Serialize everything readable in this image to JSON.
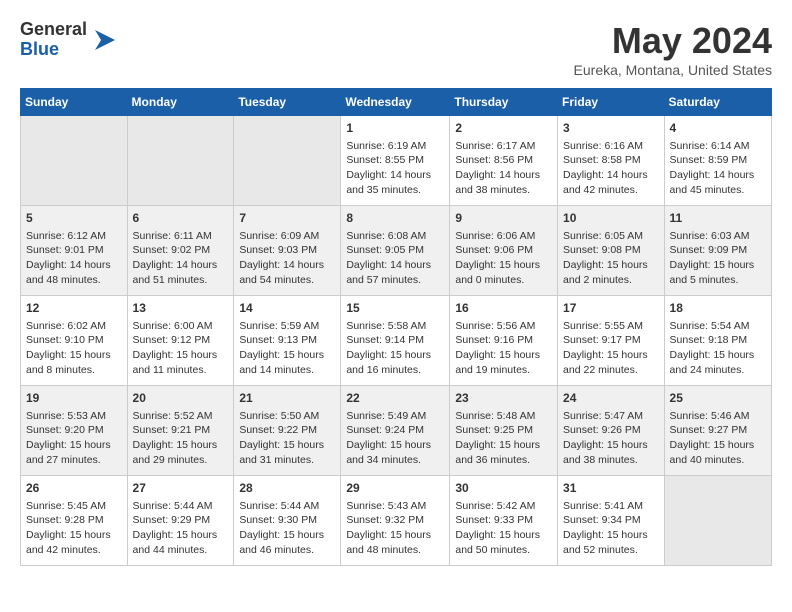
{
  "logo": {
    "general": "General",
    "blue": "Blue"
  },
  "title": "May 2024",
  "location": "Eureka, Montana, United States",
  "weekdays": [
    "Sunday",
    "Monday",
    "Tuesday",
    "Wednesday",
    "Thursday",
    "Friday",
    "Saturday"
  ],
  "weeks": [
    [
      {
        "day": "",
        "empty": true
      },
      {
        "day": "",
        "empty": true
      },
      {
        "day": "",
        "empty": true
      },
      {
        "day": "1",
        "sunrise": "Sunrise: 6:19 AM",
        "sunset": "Sunset: 8:55 PM",
        "daylight": "Daylight: 14 hours and 35 minutes."
      },
      {
        "day": "2",
        "sunrise": "Sunrise: 6:17 AM",
        "sunset": "Sunset: 8:56 PM",
        "daylight": "Daylight: 14 hours and 38 minutes."
      },
      {
        "day": "3",
        "sunrise": "Sunrise: 6:16 AM",
        "sunset": "Sunset: 8:58 PM",
        "daylight": "Daylight: 14 hours and 42 minutes."
      },
      {
        "day": "4",
        "sunrise": "Sunrise: 6:14 AM",
        "sunset": "Sunset: 8:59 PM",
        "daylight": "Daylight: 14 hours and 45 minutes."
      }
    ],
    [
      {
        "day": "5",
        "sunrise": "Sunrise: 6:12 AM",
        "sunset": "Sunset: 9:01 PM",
        "daylight": "Daylight: 14 hours and 48 minutes."
      },
      {
        "day": "6",
        "sunrise": "Sunrise: 6:11 AM",
        "sunset": "Sunset: 9:02 PM",
        "daylight": "Daylight: 14 hours and 51 minutes."
      },
      {
        "day": "7",
        "sunrise": "Sunrise: 6:09 AM",
        "sunset": "Sunset: 9:03 PM",
        "daylight": "Daylight: 14 hours and 54 minutes."
      },
      {
        "day": "8",
        "sunrise": "Sunrise: 6:08 AM",
        "sunset": "Sunset: 9:05 PM",
        "daylight": "Daylight: 14 hours and 57 minutes."
      },
      {
        "day": "9",
        "sunrise": "Sunrise: 6:06 AM",
        "sunset": "Sunset: 9:06 PM",
        "daylight": "Daylight: 15 hours and 0 minutes."
      },
      {
        "day": "10",
        "sunrise": "Sunrise: 6:05 AM",
        "sunset": "Sunset: 9:08 PM",
        "daylight": "Daylight: 15 hours and 2 minutes."
      },
      {
        "day": "11",
        "sunrise": "Sunrise: 6:03 AM",
        "sunset": "Sunset: 9:09 PM",
        "daylight": "Daylight: 15 hours and 5 minutes."
      }
    ],
    [
      {
        "day": "12",
        "sunrise": "Sunrise: 6:02 AM",
        "sunset": "Sunset: 9:10 PM",
        "daylight": "Daylight: 15 hours and 8 minutes."
      },
      {
        "day": "13",
        "sunrise": "Sunrise: 6:00 AM",
        "sunset": "Sunset: 9:12 PM",
        "daylight": "Daylight: 15 hours and 11 minutes."
      },
      {
        "day": "14",
        "sunrise": "Sunrise: 5:59 AM",
        "sunset": "Sunset: 9:13 PM",
        "daylight": "Daylight: 15 hours and 14 minutes."
      },
      {
        "day": "15",
        "sunrise": "Sunrise: 5:58 AM",
        "sunset": "Sunset: 9:14 PM",
        "daylight": "Daylight: 15 hours and 16 minutes."
      },
      {
        "day": "16",
        "sunrise": "Sunrise: 5:56 AM",
        "sunset": "Sunset: 9:16 PM",
        "daylight": "Daylight: 15 hours and 19 minutes."
      },
      {
        "day": "17",
        "sunrise": "Sunrise: 5:55 AM",
        "sunset": "Sunset: 9:17 PM",
        "daylight": "Daylight: 15 hours and 22 minutes."
      },
      {
        "day": "18",
        "sunrise": "Sunrise: 5:54 AM",
        "sunset": "Sunset: 9:18 PM",
        "daylight": "Daylight: 15 hours and 24 minutes."
      }
    ],
    [
      {
        "day": "19",
        "sunrise": "Sunrise: 5:53 AM",
        "sunset": "Sunset: 9:20 PM",
        "daylight": "Daylight: 15 hours and 27 minutes."
      },
      {
        "day": "20",
        "sunrise": "Sunrise: 5:52 AM",
        "sunset": "Sunset: 9:21 PM",
        "daylight": "Daylight: 15 hours and 29 minutes."
      },
      {
        "day": "21",
        "sunrise": "Sunrise: 5:50 AM",
        "sunset": "Sunset: 9:22 PM",
        "daylight": "Daylight: 15 hours and 31 minutes."
      },
      {
        "day": "22",
        "sunrise": "Sunrise: 5:49 AM",
        "sunset": "Sunset: 9:24 PM",
        "daylight": "Daylight: 15 hours and 34 minutes."
      },
      {
        "day": "23",
        "sunrise": "Sunrise: 5:48 AM",
        "sunset": "Sunset: 9:25 PM",
        "daylight": "Daylight: 15 hours and 36 minutes."
      },
      {
        "day": "24",
        "sunrise": "Sunrise: 5:47 AM",
        "sunset": "Sunset: 9:26 PM",
        "daylight": "Daylight: 15 hours and 38 minutes."
      },
      {
        "day": "25",
        "sunrise": "Sunrise: 5:46 AM",
        "sunset": "Sunset: 9:27 PM",
        "daylight": "Daylight: 15 hours and 40 minutes."
      }
    ],
    [
      {
        "day": "26",
        "sunrise": "Sunrise: 5:45 AM",
        "sunset": "Sunset: 9:28 PM",
        "daylight": "Daylight: 15 hours and 42 minutes."
      },
      {
        "day": "27",
        "sunrise": "Sunrise: 5:44 AM",
        "sunset": "Sunset: 9:29 PM",
        "daylight": "Daylight: 15 hours and 44 minutes."
      },
      {
        "day": "28",
        "sunrise": "Sunrise: 5:44 AM",
        "sunset": "Sunset: 9:30 PM",
        "daylight": "Daylight: 15 hours and 46 minutes."
      },
      {
        "day": "29",
        "sunrise": "Sunrise: 5:43 AM",
        "sunset": "Sunset: 9:32 PM",
        "daylight": "Daylight: 15 hours and 48 minutes."
      },
      {
        "day": "30",
        "sunrise": "Sunrise: 5:42 AM",
        "sunset": "Sunset: 9:33 PM",
        "daylight": "Daylight: 15 hours and 50 minutes."
      },
      {
        "day": "31",
        "sunrise": "Sunrise: 5:41 AM",
        "sunset": "Sunset: 9:34 PM",
        "daylight": "Daylight: 15 hours and 52 minutes."
      },
      {
        "day": "",
        "empty": true
      }
    ]
  ]
}
